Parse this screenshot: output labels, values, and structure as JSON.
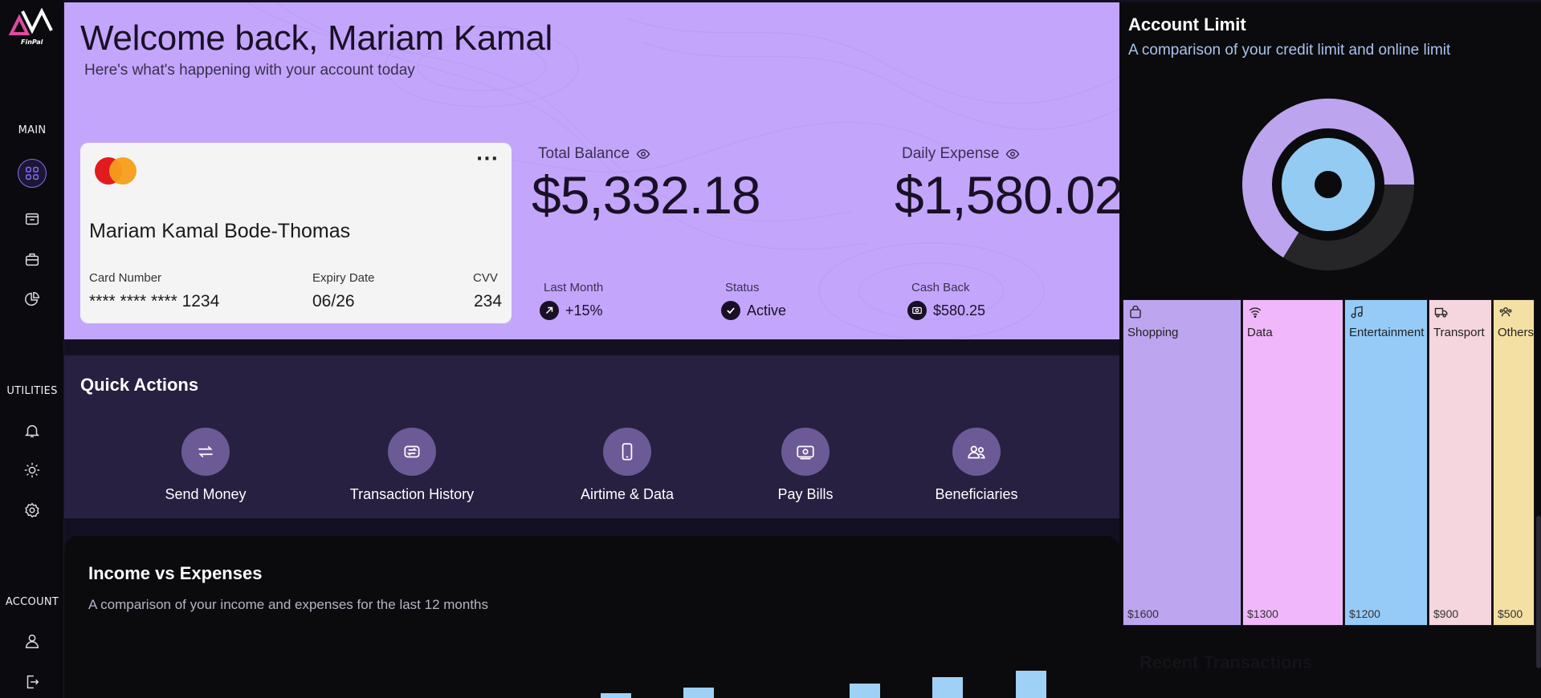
{
  "app": {
    "logo_text": "FinPal"
  },
  "sidebar": {
    "sections": {
      "main": "MAIN",
      "utilities": "UTILITIES",
      "account": "ACCOUNT"
    },
    "icons": [
      "dashboard-icon",
      "inbox-icon",
      "briefcase-icon",
      "pie-chart-icon",
      "bell-icon",
      "sun-icon",
      "gear-icon",
      "user-icon",
      "logout-icon"
    ]
  },
  "hero": {
    "welcome": "Welcome back, Mariam Kamal",
    "subtitle": "Here's what's happening with your account today"
  },
  "card": {
    "holder": "Mariam Kamal Bode-Thomas",
    "number_label": "Card Number",
    "number": "**** **** **** 1234",
    "expiry_label": "Expiry Date",
    "expiry": "06/26",
    "cvv_label": "CVV",
    "cvv": "234",
    "menu": "···"
  },
  "stats": {
    "total_balance_label": "Total Balance",
    "total_balance": "$5,332.18",
    "daily_expense_label": "Daily Expense",
    "daily_expense": "$1,580.02",
    "last_month_label": "Last Month",
    "last_month": "+15%",
    "status_label": "Status",
    "status": "Active",
    "cashback_label": "Cash Back",
    "cashback": "$580.25"
  },
  "quick_actions": {
    "title": "Quick Actions",
    "items": [
      {
        "label": "Send Money",
        "icon": "transfer-icon"
      },
      {
        "label": "Transaction History",
        "icon": "refresh-icon"
      },
      {
        "label": "Airtime & Data",
        "icon": "phone-icon"
      },
      {
        "label": "Pay Bills",
        "icon": "bill-icon"
      },
      {
        "label": "Beneficiaries",
        "icon": "users-icon"
      }
    ]
  },
  "income_expenses": {
    "title": "Income vs Expenses",
    "subtitle": "A comparison of your income and expenses for the last 12 months"
  },
  "account_limit": {
    "title": "Account Limit",
    "subtitle": "A comparison of your credit limit and online limit"
  },
  "categories": [
    {
      "name": "Shopping",
      "value": "$1600",
      "color": "#bda5ef",
      "icon": "bag-icon"
    },
    {
      "name": "Data",
      "value": "$1300",
      "color": "#f0b8fa",
      "icon": "wifi-icon"
    },
    {
      "name": "Entertainment",
      "value": "$1200",
      "color": "#96cbf8",
      "icon": "music-icon"
    },
    {
      "name": "Transport",
      "value": "$900",
      "color": "#f5d6df",
      "icon": "truck-icon"
    },
    {
      "name": "Others",
      "value": "$500",
      "color": "#f5e0a4",
      "icon": "group-icon"
    }
  ],
  "recent_transactions": {
    "title": "Recent Transactions"
  },
  "colors": {
    "accent": "#c3a6fb",
    "dark": "#0b0b0f",
    "quick_actions_bg": "#272040",
    "bar": "#9fd0f5"
  }
}
